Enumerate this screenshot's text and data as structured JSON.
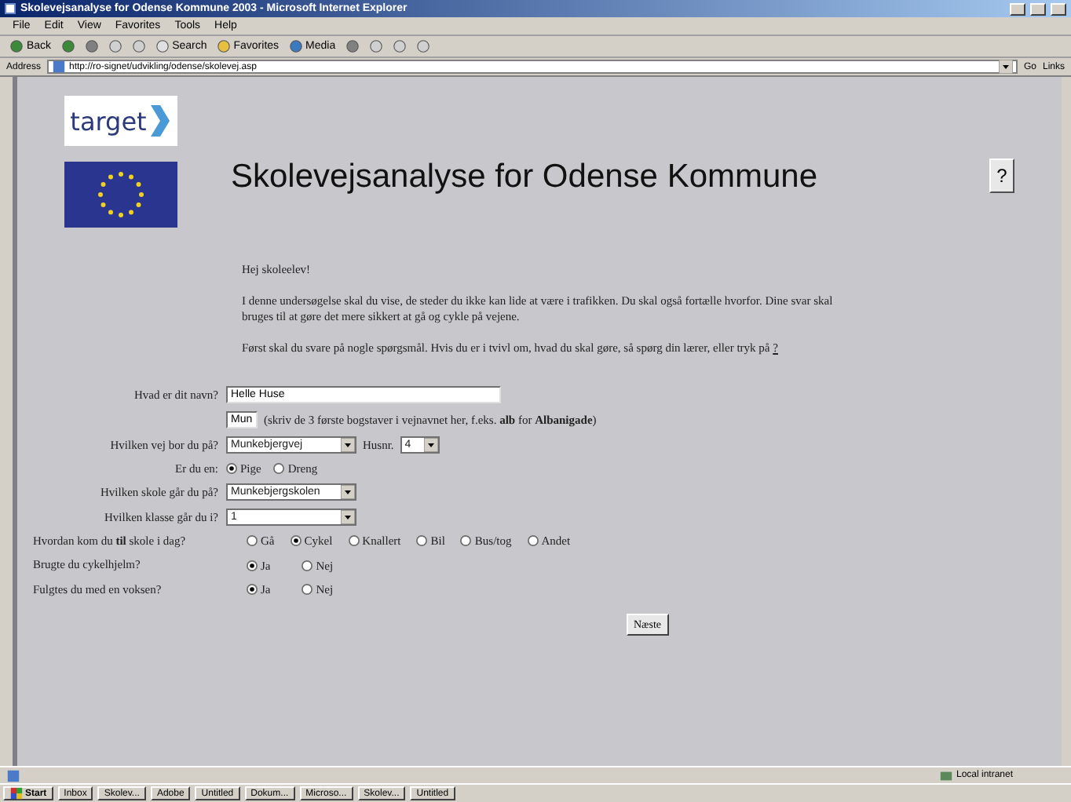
{
  "window": {
    "title": "Skolevejsanalyse for Odense Kommune 2003 - Microsoft Internet Explorer"
  },
  "menu": [
    "File",
    "Edit",
    "View",
    "Favorites",
    "Tools",
    "Help"
  ],
  "toolbar": [
    "Back",
    "Search",
    "Favorites",
    "Media"
  ],
  "address": {
    "label": "Address",
    "url": "http://ro-signet/udvikling/odense/skolevej.asp",
    "go": "Go",
    "links": "Links"
  },
  "page": {
    "logo": "target",
    "title": "Skolevejsanalyse for Odense Kommune",
    "help_button": "?",
    "greeting": "Hej skoleelev!",
    "paragraphs": [
      "I denne undersøgelse skal du vise, de steder du ikke kan lide at være i trafikken. Du skal også fortælle hvorfor. Dine svar skal bruges til at gøre det mere sikkert at gå og cykle på vejene."
    ],
    "help_line": {
      "text": "Først skal du svare på nogle spørgsmål. Hvis du er i tvivl om, hvad du skal gøre, så spørg din lærer, eller tryk på",
      "link": "?"
    },
    "fields": [
      {
        "kind": "text",
        "label": "Hvad er dit navn?",
        "value": "Helle Huse"
      },
      {
        "kind": "short",
        "value": "Mun",
        "hint": "(skriv de 3 første bogstaver i vejnavnet her, f.eks. **alb** for **Albanigade**)"
      },
      {
        "kind": "select",
        "label": "Hvilken vej bor du på?",
        "value": "Munkebjergvej",
        "extra_label": "Husnr.",
        "extra_value": "4"
      },
      {
        "kind": "radio",
        "label": "Er du en:",
        "options": [
          {
            "label": "Pige",
            "selected": true
          },
          {
            "label": "Dreng",
            "selected": false
          }
        ]
      },
      {
        "kind": "select",
        "label": "Hvilken skole går du på?",
        "value": "Munkebjergskolen"
      },
      {
        "kind": "select",
        "label": "Hvilken klasse går du i?",
        "value": "1"
      }
    ],
    "questions": [
      {
        "label": "Hvordan kom du **til** skole i dag?",
        "options": [
          {
            "label": "Gå",
            "selected": false
          },
          {
            "label": "Cykel",
            "selected": true
          },
          {
            "label": "Knallert",
            "selected": false
          },
          {
            "label": "Bil",
            "selected": false
          },
          {
            "label": "Bus/tog",
            "selected": false
          },
          {
            "label": "Andet",
            "selected": false
          }
        ]
      },
      {
        "label": "Brugte du cykelhjelm?",
        "options": [
          {
            "label": "Ja",
            "selected": true
          },
          {
            "label": "Nej",
            "selected": false
          }
        ]
      },
      {
        "label": "Fulgtes du med en voksen?",
        "options": [
          {
            "label": "Ja",
            "selected": true
          },
          {
            "label": "Nej",
            "selected": false
          }
        ]
      }
    ],
    "next_button": "Næste"
  },
  "status_bar": {
    "zone": "Local intranet"
  },
  "taskbar": {
    "start": "Start",
    "items": [
      "Inbox",
      "Skolev...",
      "Adobe",
      "Untitled",
      "Dokum...",
      "Microso...",
      "Skolev...",
      "Untitled"
    ]
  }
}
